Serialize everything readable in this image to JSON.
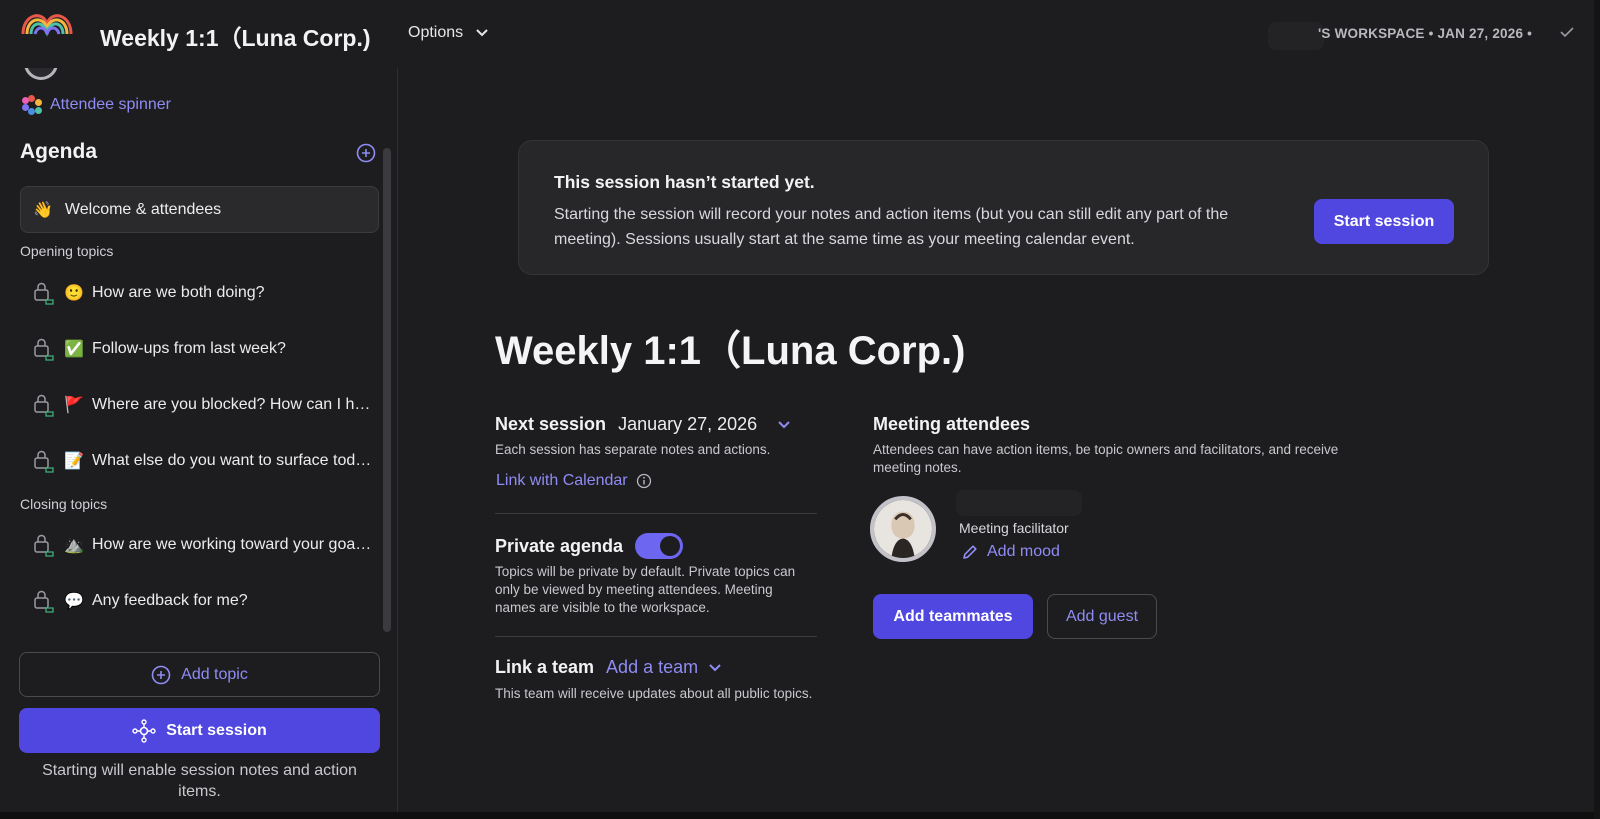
{
  "header": {
    "title": "Weekly 1:1（Luna Corp.)",
    "options_label": "Options",
    "workspace_text": "'S WORKSPACE • JAN 27, 2026 •"
  },
  "sidebar": {
    "attendee_spinner": "Attendee spinner",
    "agenda_title": "Agenda",
    "welcome_item": {
      "emoji": "👋",
      "label": "Welcome & attendees"
    },
    "opening_label": "Opening topics",
    "opening_topics": [
      {
        "emoji": "🙂",
        "label": "How are we both doing?"
      },
      {
        "emoji": "✅",
        "label": "Follow-ups from last week?"
      },
      {
        "emoji": "🚩",
        "label": "Where are you blocked? How can I help?"
      },
      {
        "emoji": "📝",
        "label": "What else do you want to surface today?"
      }
    ],
    "closing_label": "Closing topics",
    "closing_topics": [
      {
        "emoji": "⛰️",
        "label": "How are we working toward your goals?"
      },
      {
        "emoji": "💬",
        "label": "Any feedback for me?"
      }
    ],
    "add_topic": "Add topic",
    "start_session": "Start session",
    "start_hint": "Starting will enable session notes and action items."
  },
  "banner": {
    "title": "This session hasn’t started yet.",
    "body": "Starting the session will record your notes and action items (but you can still edit any part of the meeting). Sessions usually start at the same time as your meeting calendar event.",
    "button": "Start session"
  },
  "main": {
    "title": "Weekly 1:1（Luna Corp.)",
    "next_session_label": "Next session",
    "next_session_date": "January 27, 2026",
    "next_session_desc": "Each session has separate notes and actions.",
    "link_calendar": "Link with Calendar",
    "private_agenda_label": "Private agenda",
    "private_agenda_on": true,
    "private_agenda_desc": "Topics will be private by default. Private topics can only be viewed by meeting attendees. Meeting names are visible to the workspace.",
    "link_team_label": "Link a team",
    "add_team": "Add a team",
    "team_desc": "This team will receive updates about all public topics."
  },
  "attendees": {
    "title": "Meeting attendees",
    "desc": "Attendees can have action items, be topic owners and facilitators, and receive meeting notes.",
    "role": "Meeting facilitator",
    "add_mood": "Add mood",
    "add_teammates": "Add teammates",
    "add_guest": "Add guest"
  },
  "colors": {
    "accent": "#5046e0",
    "link": "#8f8cf3",
    "background": "#1d1d1f",
    "panel": "#27272a"
  }
}
